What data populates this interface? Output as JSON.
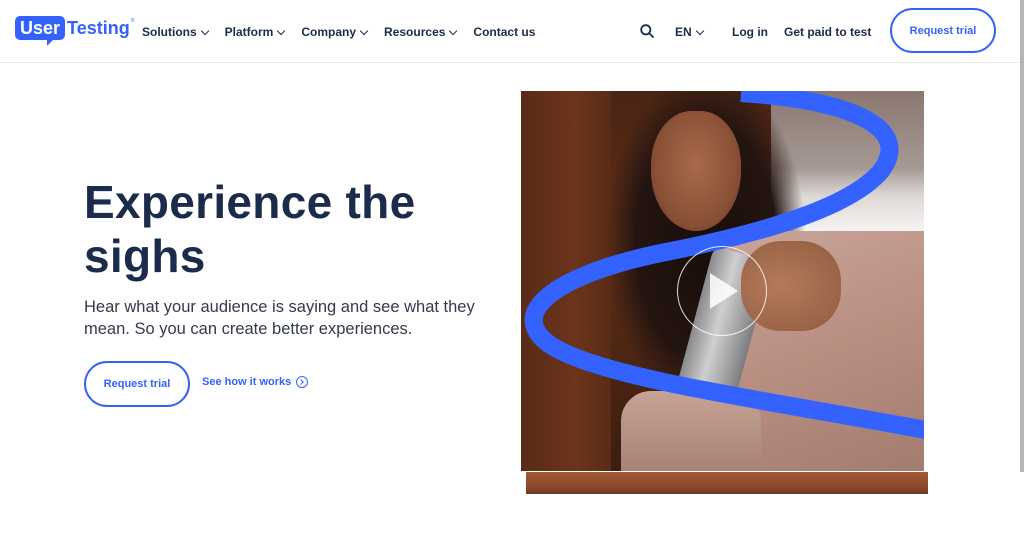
{
  "brand": {
    "logo_part1": "User",
    "logo_part2": "Testing",
    "logo_mark": "®",
    "accent_color": "#3462ff",
    "text_color": "#1b2b4b"
  },
  "nav": {
    "items": [
      {
        "label": "Solutions",
        "has_dropdown": true
      },
      {
        "label": "Platform",
        "has_dropdown": true
      },
      {
        "label": "Company",
        "has_dropdown": true
      },
      {
        "label": "Resources",
        "has_dropdown": true
      },
      {
        "label": "Contact us",
        "has_dropdown": false
      }
    ],
    "search_icon": "search-icon",
    "language": "EN",
    "login_label": "Log in",
    "paid_label": "Get paid to test",
    "request_trial_label": "Request trial"
  },
  "hero": {
    "title": "Experience the sighs",
    "subtitle": "Hear what your audience is saying and see what they mean. So you can create better experiences.",
    "primary_cta": "Request trial",
    "secondary_cta": "See how it works",
    "secondary_icon": "circle-arrow-right-icon",
    "media": {
      "description": "Woman holding a metal bottle with a blue swoosh overlay",
      "play_icon": "play-icon"
    }
  }
}
